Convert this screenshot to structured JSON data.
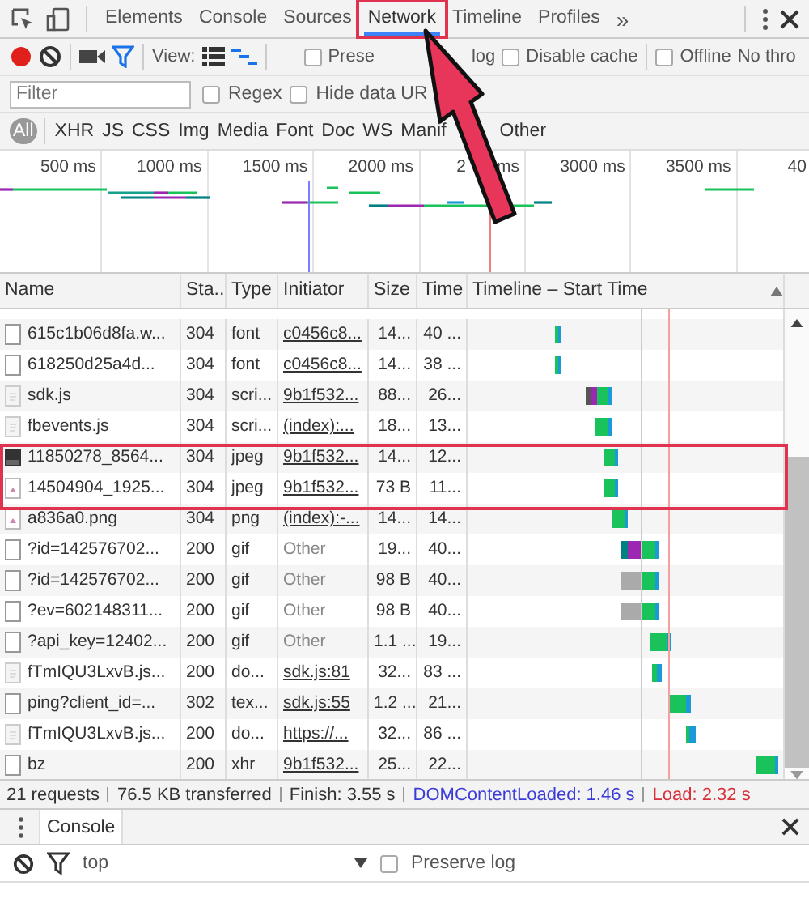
{
  "tabs": [
    {
      "label": "Elements",
      "selected": false,
      "annotated": false
    },
    {
      "label": "Console",
      "selected": false,
      "annotated": false
    },
    {
      "label": "Sources",
      "selected": false,
      "annotated": false
    },
    {
      "label": "Network",
      "selected": true,
      "annotated": true
    },
    {
      "label": "Timeline",
      "selected": false,
      "annotated": false
    },
    {
      "label": "Profiles",
      "selected": false,
      "annotated": false
    }
  ],
  "more_tabs": "»",
  "toolbar": {
    "recording": true,
    "view_label": "View:",
    "checkboxes": [
      {
        "label": "Prese",
        "label_after": "log",
        "checked": false
      },
      {
        "label": "Disable cache",
        "checked": false
      },
      {
        "label": "Offline",
        "checked": false
      }
    ],
    "throttle": "No thro"
  },
  "filter": {
    "placeholder": "Filter",
    "checkboxes": [
      {
        "label": "Regex",
        "checked": false
      },
      {
        "label": "Hide data UR",
        "checked": false
      }
    ]
  },
  "types": [
    {
      "label": "All",
      "selected": true
    },
    {
      "label": "XHR",
      "selected": false
    },
    {
      "label": "JS",
      "selected": false
    },
    {
      "label": "CSS",
      "selected": false
    },
    {
      "label": "Img",
      "selected": false
    },
    {
      "label": "Media",
      "selected": false
    },
    {
      "label": "Font",
      "selected": false
    },
    {
      "label": "Doc",
      "selected": false
    },
    {
      "label": "WS",
      "selected": false
    },
    {
      "label": "Manif",
      "selected": false
    },
    {
      "label": "Other",
      "selected": false
    }
  ],
  "overview_ticks": [
    {
      "label": "500 ms"
    },
    {
      "label": "1000 ms"
    },
    {
      "label": "1500 ms"
    },
    {
      "label": "2000 ms"
    },
    {
      "label": "2",
      "label_after": "ms"
    },
    {
      "label": "3000 ms"
    },
    {
      "label": "3500 ms"
    },
    {
      "label": "40"
    }
  ],
  "columns": [
    "Name",
    "Sta...",
    "Type",
    "Initiator",
    "Size",
    "Time",
    "Timeline – Start Time"
  ],
  "rows": [
    {
      "kind": "file",
      "name": "615c1b06d8fa.w...",
      "status": "304",
      "type": "font",
      "initiator": "c0456c8...",
      "link": true,
      "size": "14...",
      "time": "40 ..."
    },
    {
      "kind": "file",
      "name": "618250d25a4d...",
      "status": "304",
      "type": "font",
      "initiator": "c0456c8...",
      "link": true,
      "size": "14...",
      "time": "38 ..."
    },
    {
      "kind": "script",
      "name": "sdk.js",
      "status": "304",
      "type": "scri...",
      "initiator": "9b1f532...",
      "link": true,
      "size": "88...",
      "time": "26..."
    },
    {
      "kind": "script",
      "name": "fbevents.js",
      "status": "304",
      "type": "scri...",
      "initiator": "(index):...",
      "link": true,
      "size": "18...",
      "time": "13..."
    },
    {
      "kind": "photo",
      "name": "11850278_8564...",
      "status": "304",
      "type": "jpeg",
      "initiator": "9b1f532...",
      "link": true,
      "size": "14...",
      "time": "12..."
    },
    {
      "kind": "image",
      "name": "14504904_1925...",
      "status": "304",
      "type": "jpeg",
      "initiator": "9b1f532...",
      "link": true,
      "size": "73 B",
      "time": "11..."
    },
    {
      "kind": "image",
      "name": "a836a0.png",
      "status": "304",
      "type": "png",
      "initiator": "(index):-...",
      "link": true,
      "size": "14...",
      "time": "14..."
    },
    {
      "kind": "file",
      "name": "?id=142576702...",
      "status": "200",
      "type": "gif",
      "initiator": "Other",
      "link": false,
      "size": "19...",
      "time": "40..."
    },
    {
      "kind": "file",
      "name": "?id=142576702...",
      "status": "200",
      "type": "gif",
      "initiator": "Other",
      "link": false,
      "size": "98 B",
      "time": "40..."
    },
    {
      "kind": "file",
      "name": "?ev=602148311...",
      "status": "200",
      "type": "gif",
      "initiator": "Other",
      "link": false,
      "size": "98 B",
      "time": "40..."
    },
    {
      "kind": "file",
      "name": "?api_key=12402...",
      "status": "200",
      "type": "gif",
      "initiator": "Other",
      "link": false,
      "size": "1.1 ...",
      "time": "19..."
    },
    {
      "kind": "script",
      "name": "fTmIQU3LxvB.js...",
      "status": "200",
      "type": "do...",
      "initiator": "sdk.js:81",
      "link": true,
      "size": "32...",
      "time": "83 ..."
    },
    {
      "kind": "file",
      "name": "ping?client_id=...",
      "status": "302",
      "type": "tex...",
      "initiator": "sdk.js:55",
      "link": true,
      "size": "1.2 ...",
      "time": "21..."
    },
    {
      "kind": "script",
      "name": "fTmIQU3LxvB.js...",
      "status": "200",
      "type": "do...",
      "initiator": "https://...",
      "link": true,
      "size": "32...",
      "time": "86 ..."
    },
    {
      "kind": "file",
      "name": "bz",
      "status": "200",
      "type": "xhr",
      "initiator": "9b1f532...",
      "link": true,
      "size": "25...",
      "time": "22..."
    }
  ],
  "summary": [
    {
      "kind": "plain",
      "text": "21 requests"
    },
    {
      "kind": "plain",
      "text": "76.5 KB transferred"
    },
    {
      "kind": "plain",
      "text": "Finish: 3.55 s"
    },
    {
      "kind": "dom",
      "text": "DOMContentLoaded: 1.46 s"
    },
    {
      "kind": "load",
      "text": "Load: 2.32 s"
    }
  ],
  "drawer": {
    "tab": "Console",
    "context": "top",
    "preserve": {
      "label": "Preserve log",
      "checked": false
    }
  }
}
